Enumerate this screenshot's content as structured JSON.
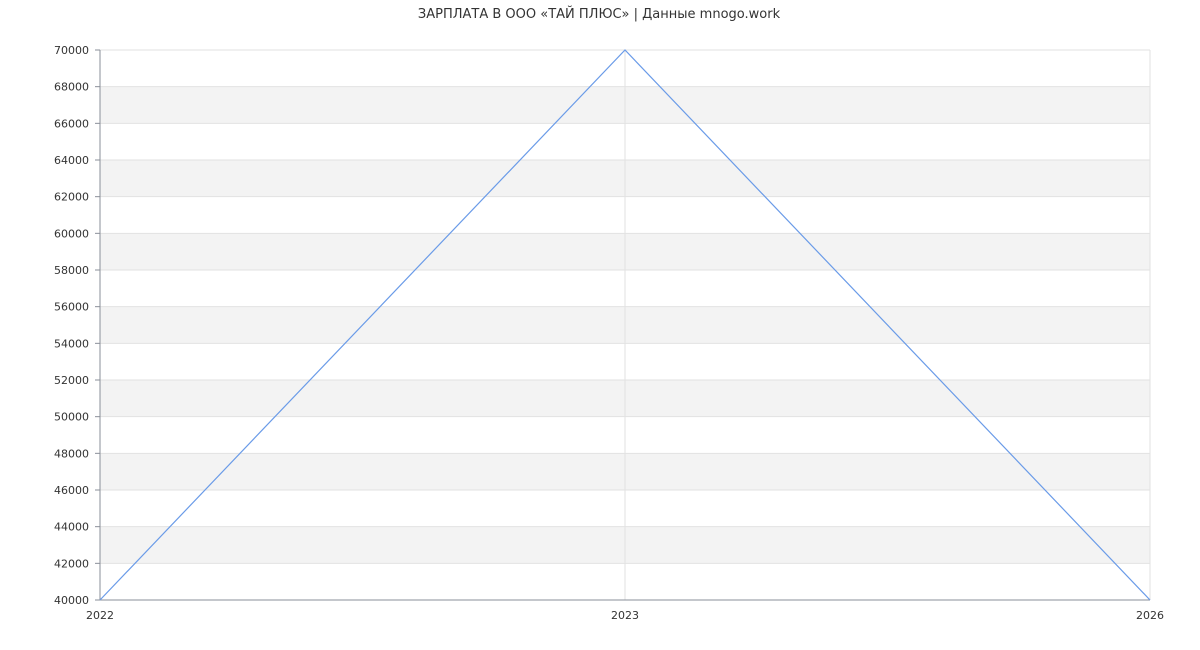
{
  "chart_data": {
    "type": "line",
    "title": "ЗАРПЛАТА В ООО «ТАЙ ПЛЮС» | Данные mnogo.work",
    "xlabel": "",
    "ylabel": "",
    "x_ticks": [
      "2022",
      "2023",
      "2026"
    ],
    "x": [
      "2022",
      "2023",
      "2026"
    ],
    "series": [
      {
        "values": [
          40000,
          70000,
          40000
        ]
      }
    ],
    "ylim": [
      40000,
      70000
    ],
    "y_ticks": [
      40000,
      42000,
      44000,
      46000,
      48000,
      50000,
      52000,
      54000,
      56000,
      58000,
      60000,
      62000,
      64000,
      66000,
      68000,
      70000
    ],
    "grid": true,
    "legend": "none",
    "colors": {
      "line": "#6a9be8",
      "band": "#f3f3f3",
      "grid": "#e2e2e2",
      "axis": "#8a8f99",
      "text": "#333333"
    }
  }
}
